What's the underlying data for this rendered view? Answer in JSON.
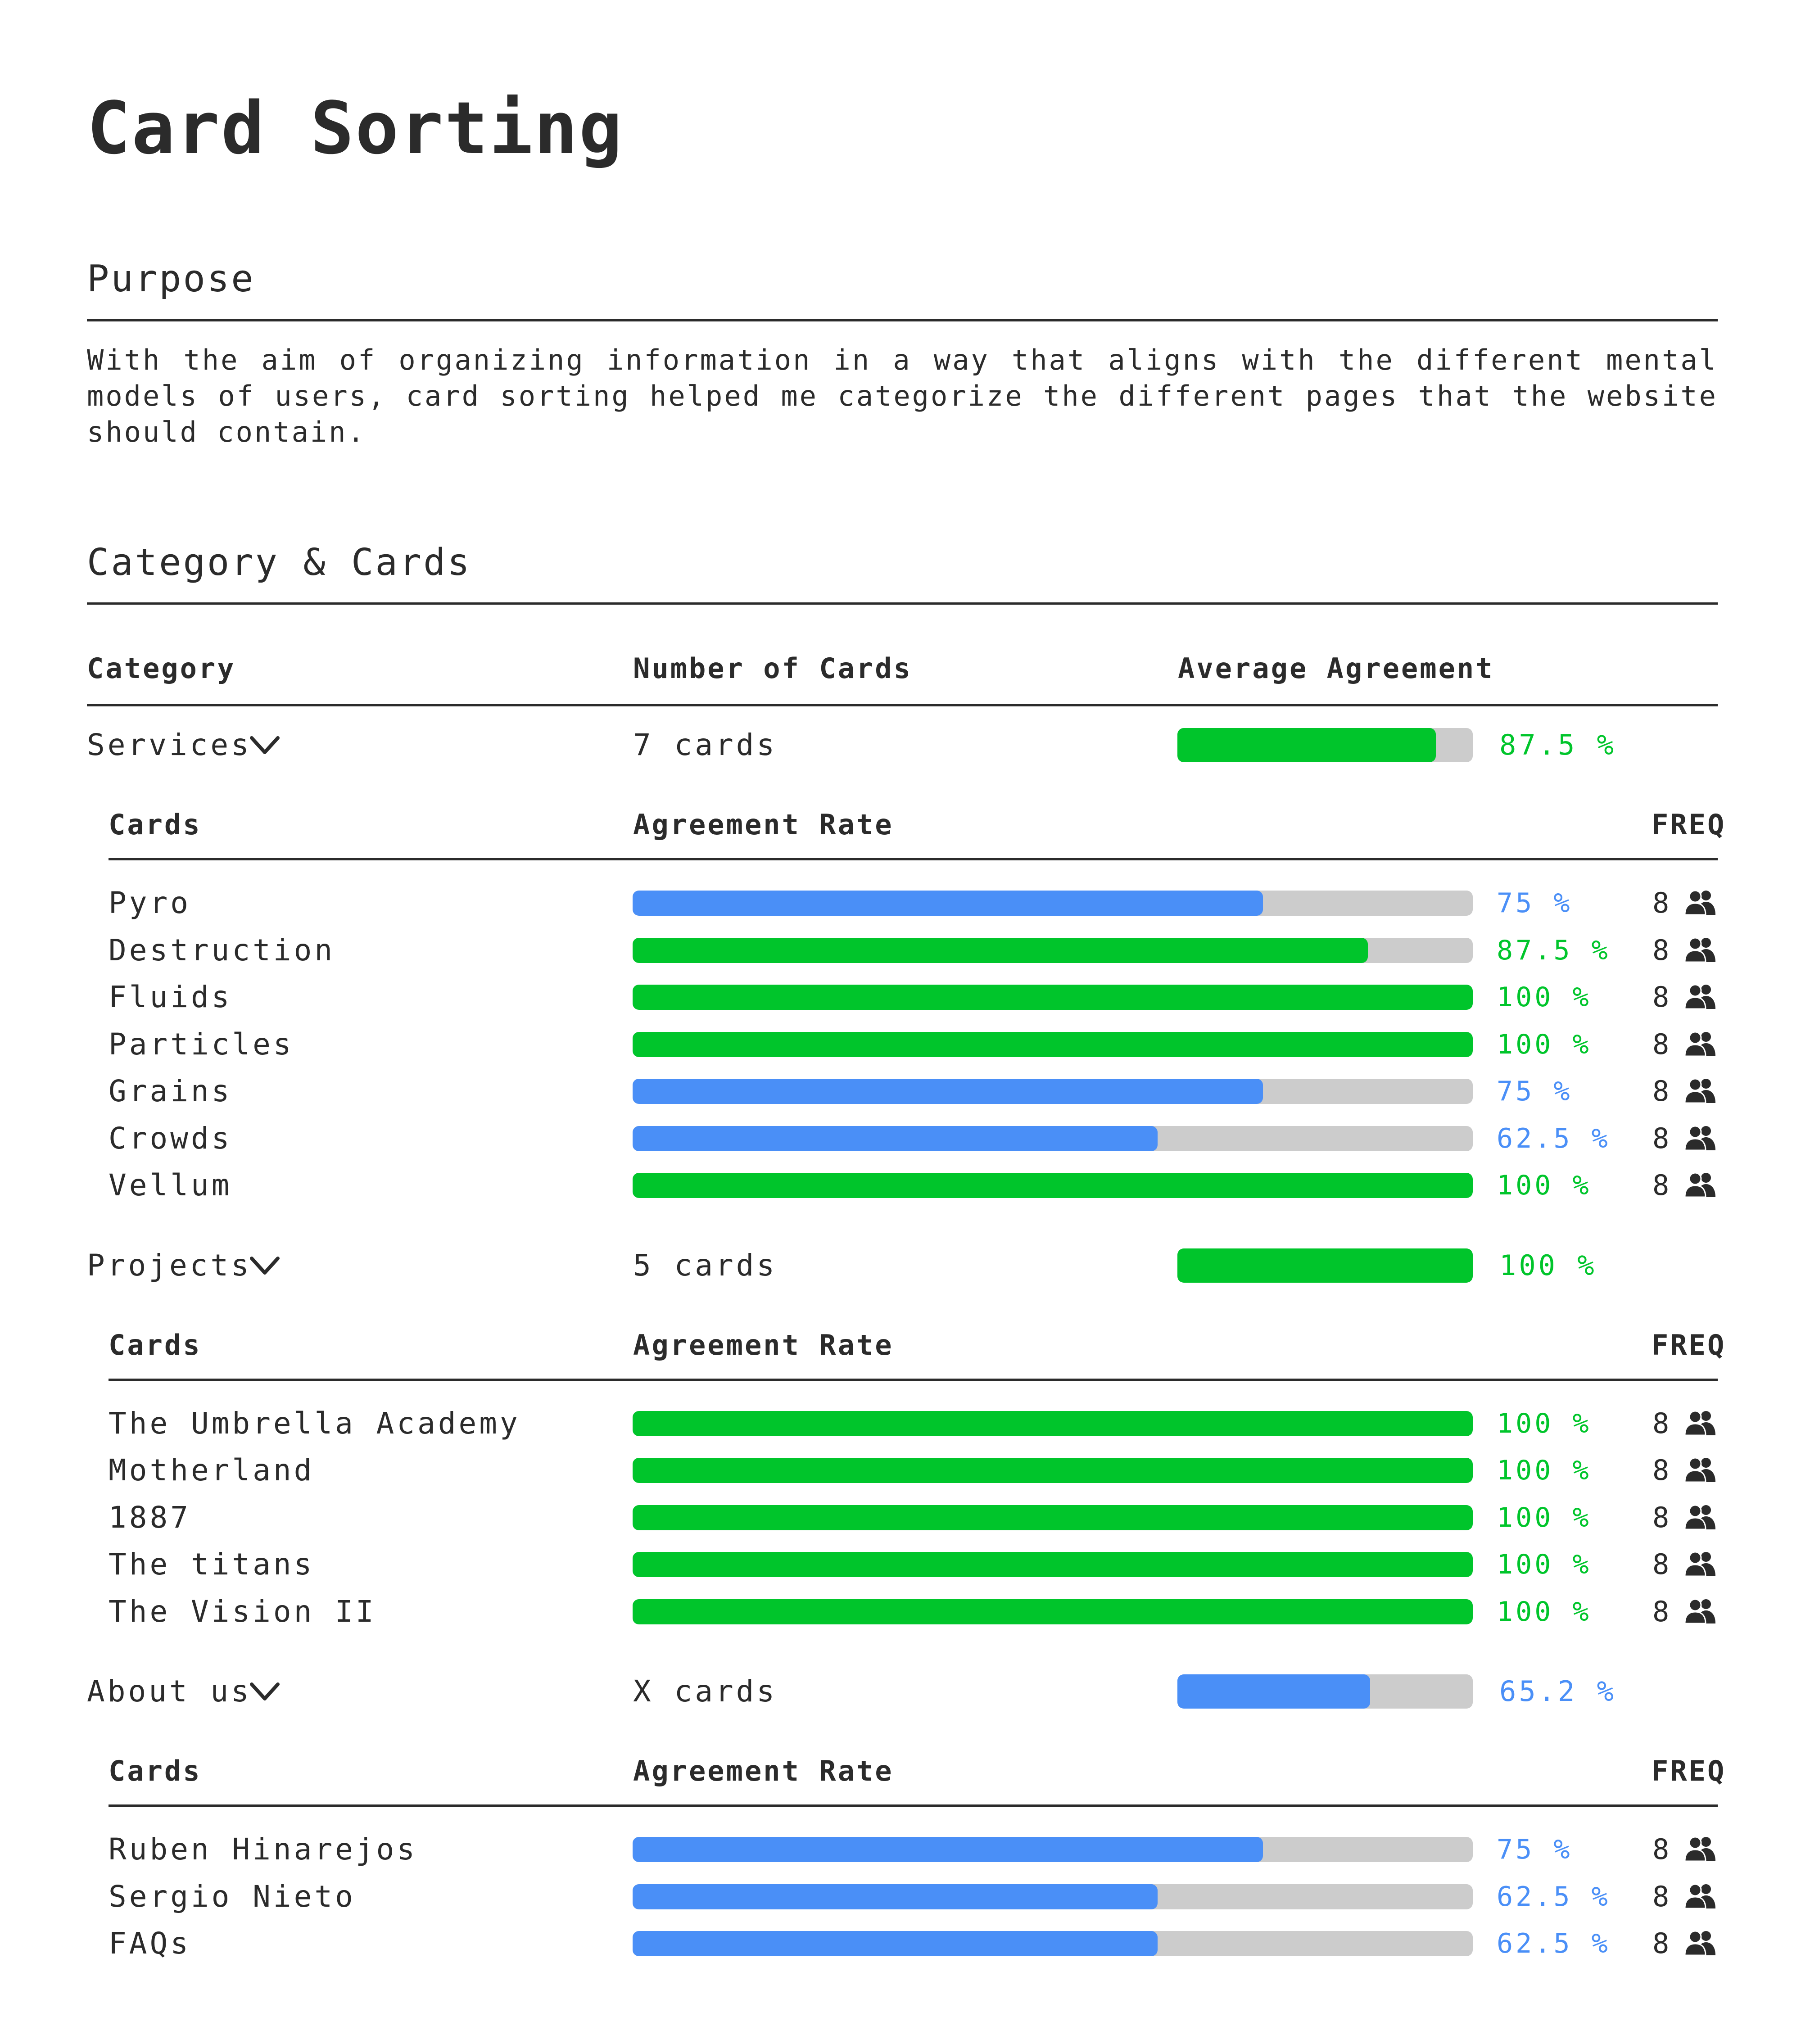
{
  "title": "Card Sorting",
  "purpose": {
    "heading": "Purpose",
    "text": "With the aim of organizing information in a way that aligns with the different mental models of users, card sorting helped me categorize the different pages that the website should contain."
  },
  "categories_section": {
    "heading": "Category & Cards",
    "columns": {
      "category": "Category",
      "count": "Number of Cards",
      "agreement": "Average Agreement"
    },
    "card_columns": {
      "cards": "Cards",
      "rate": "Agreement Rate",
      "freq": "FREQ"
    }
  },
  "colors": {
    "high": "#00c52b",
    "mid": "#4a8ff7",
    "track": "#cccccc",
    "text": "#2b2b2b"
  },
  "icons": {
    "expand": "chevron-down-icon",
    "freq": "users-icon"
  },
  "categories": [
    {
      "name": "Services",
      "count": "7 cards",
      "agreement": 87.5,
      "agreement_label": "87.5 %",
      "color": "#00c52b",
      "cards": [
        {
          "name": "Pyro",
          "rate": 75,
          "rate_label": "75 %",
          "color": "#4a8ff7",
          "freq": "8"
        },
        {
          "name": "Destruction",
          "rate": 87.5,
          "rate_label": "87.5 %",
          "color": "#00c52b",
          "freq": "8"
        },
        {
          "name": "Fluids",
          "rate": 100,
          "rate_label": "100 %",
          "color": "#00c52b",
          "freq": "8"
        },
        {
          "name": "Particles",
          "rate": 100,
          "rate_label": "100 %",
          "color": "#00c52b",
          "freq": "8"
        },
        {
          "name": "Grains",
          "rate": 75,
          "rate_label": "75 %",
          "color": "#4a8ff7",
          "freq": "8"
        },
        {
          "name": "Crowds",
          "rate": 62.5,
          "rate_label": "62.5 %",
          "color": "#4a8ff7",
          "freq": "8"
        },
        {
          "name": "Vellum",
          "rate": 100,
          "rate_label": "100 %",
          "color": "#00c52b",
          "freq": "8"
        }
      ]
    },
    {
      "name": "Projects",
      "count": "5 cards",
      "agreement": 100,
      "agreement_label": "100 %",
      "color": "#00c52b",
      "cards": [
        {
          "name": "The Umbrella Academy",
          "rate": 100,
          "rate_label": "100 %",
          "color": "#00c52b",
          "freq": "8"
        },
        {
          "name": "Motherland",
          "rate": 100,
          "rate_label": "100 %",
          "color": "#00c52b",
          "freq": "8"
        },
        {
          "name": "1887",
          "rate": 100,
          "rate_label": "100 %",
          "color": "#00c52b",
          "freq": "8"
        },
        {
          "name": "The titans",
          "rate": 100,
          "rate_label": "100 %",
          "color": "#00c52b",
          "freq": "8"
        },
        {
          "name": "The Vision II",
          "rate": 100,
          "rate_label": "100 %",
          "color": "#00c52b",
          "freq": "8"
        }
      ]
    },
    {
      "name": "About us",
      "count": "X cards",
      "agreement": 65.2,
      "agreement_label": "65.2 %",
      "color": "#4a8ff7",
      "cards": [
        {
          "name": "Ruben Hinarejos",
          "rate": 75,
          "rate_label": "75 %",
          "color": "#4a8ff7",
          "freq": "8"
        },
        {
          "name": "Sergio Nieto",
          "rate": 62.5,
          "rate_label": "62.5 %",
          "color": "#4a8ff7",
          "freq": "8"
        },
        {
          "name": "FAQs",
          "rate": 62.5,
          "rate_label": "62.5 %",
          "color": "#4a8ff7",
          "freq": "8"
        }
      ]
    }
  ]
}
